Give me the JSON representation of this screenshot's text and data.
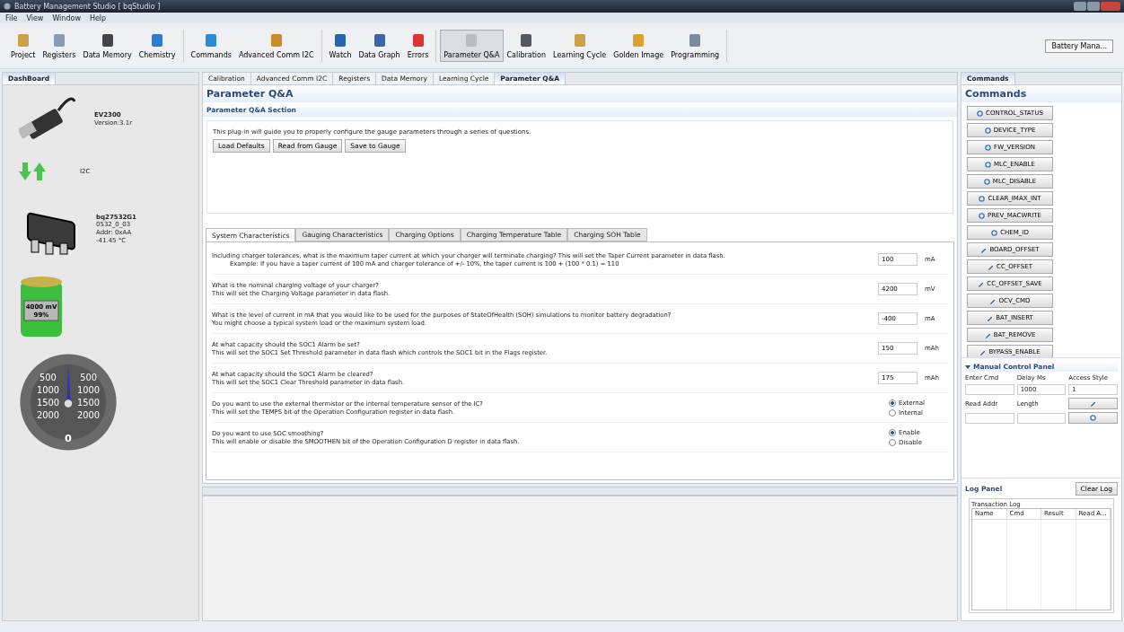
{
  "window": {
    "title": "Battery Management Studio [ bqStudio ]"
  },
  "menu": [
    "File",
    "View",
    "Window",
    "Help"
  ],
  "toolbar": {
    "groups": [
      [
        {
          "label": "Project",
          "selected": false
        },
        {
          "label": "Registers",
          "selected": false
        },
        {
          "label": "Data Memory",
          "selected": false
        },
        {
          "label": "Chemistry",
          "selected": false
        }
      ],
      [
        {
          "label": "Commands",
          "selected": false
        },
        {
          "label": "Advanced Comm I2C",
          "selected": false
        }
      ],
      [
        {
          "label": "Watch",
          "selected": false
        },
        {
          "label": "Data Graph",
          "selected": false
        },
        {
          "label": "Errors",
          "selected": false
        }
      ],
      [
        {
          "label": "Parameter Q&A",
          "selected": true
        },
        {
          "label": "Calibration",
          "selected": false
        },
        {
          "label": "Learning Cycle",
          "selected": false
        },
        {
          "label": "Golden Image",
          "selected": false
        },
        {
          "label": "Programming",
          "selected": false
        }
      ]
    ],
    "perspective": "Battery Mana..."
  },
  "dashboard": {
    "tab": "DashBoard",
    "adapter": {
      "name": "EV2300",
      "version": "Version:3.1r"
    },
    "bus": "I2C",
    "gauge_device": {
      "name": "bq27532G1",
      "lines": [
        "0532_0_03",
        "Addr: 0xAA",
        "-41.45 °C"
      ]
    },
    "battery": {
      "voltage": "4000 mV",
      "charge": "99%",
      "level": 0.99
    },
    "dial": {
      "labels": [
        "500",
        "500",
        "1000",
        "1000",
        "1500",
        "1500",
        "2000",
        "2000"
      ],
      "reading": "0"
    }
  },
  "editor_tabs": [
    {
      "label": "Calibration",
      "selected": false
    },
    {
      "label": "Advanced Comm I2C",
      "selected": false
    },
    {
      "label": "Registers",
      "selected": false
    },
    {
      "label": "Data Memory",
      "selected": false
    },
    {
      "label": "Learning Cycle",
      "selected": false
    },
    {
      "label": "Parameter Q&A",
      "selected": true
    }
  ],
  "parameter_qa": {
    "title": "Parameter Q&A",
    "section": "Parameter Q&A Section",
    "intro": "This plug-in will guide you to properly configure the gauge parameters through a series of questions.",
    "buttons": [
      "Load Defaults",
      "Read from Gauge",
      "Save to Gauge"
    ],
    "tabs": [
      {
        "label": "System Characteristics",
        "selected": true
      },
      {
        "label": "Gauging Characteristics",
        "selected": false
      },
      {
        "label": "Charging Options",
        "selected": false
      },
      {
        "label": "Charging Temperature Table",
        "selected": false
      },
      {
        "label": "Charging SOH Table",
        "selected": false
      }
    ],
    "questions": [
      {
        "kind": "number",
        "lines": [
          "Including charger tolerances, what is the maximum taper current at which your charger will terminate charging?  This will set the Taper Current parameter in data flash.",
          "Example: If you have a taper current of 100 mA and charger tolerance of +/- 10%, the taper current is 100 + (100 * 0.1) = 110"
        ],
        "value": "100",
        "unit": "mA"
      },
      {
        "kind": "number",
        "lines": [
          "What is the nominal charging voltage of your charger?",
          "This will set the Charging Voltage parameter in data flash."
        ],
        "value": "4200",
        "unit": "mV"
      },
      {
        "kind": "number",
        "lines": [
          "What is the level of current in mA that you would like to be used for the purposes of StateOfHealth (SOH) simulations to monitor battery degradation?",
          "You might choose a typical system load or the maximum system load."
        ],
        "value": "-400",
        "unit": "mA"
      },
      {
        "kind": "number",
        "lines": [
          "At what capacity should the SOC1 Alarm be set?",
          "This will set the SOC1 Set Threshold parameter in data flash which controls the SOC1 bit in the Flags register."
        ],
        "value": "150",
        "unit": "mAh"
      },
      {
        "kind": "number",
        "lines": [
          "At what capacity should the SOC1 Alarm be cleared?",
          "This will set the SOC1 Clear Threshold parameter in data flash."
        ],
        "value": "175",
        "unit": "mAh"
      },
      {
        "kind": "radio",
        "lines": [
          "Do you want to use the external thermistor or the internal temperature sensor of the IC?",
          "This will set the TEMPS bit of the Operation Configuration register in data flash."
        ],
        "options": [
          {
            "label": "External",
            "selected": true
          },
          {
            "label": "Internal",
            "selected": false
          }
        ]
      },
      {
        "kind": "radio",
        "lines": [
          "Do you want to use SOC smoothing?",
          "This will enable or disable the SMOOTHEN bit of the Operation Configuration D register in data flash."
        ],
        "options": [
          {
            "label": "Enable",
            "selected": true
          },
          {
            "label": "Disable",
            "selected": false
          }
        ]
      }
    ]
  },
  "commands_panel": {
    "tab": "Commands",
    "title": "Commands",
    "commands": [
      {
        "label": "CONTROL_STATUS",
        "kind": "read"
      },
      {
        "label": "DEVICE_TYPE",
        "kind": "read"
      },
      {
        "label": "FW_VERSION",
        "kind": "read"
      },
      {
        "label": "MLC_ENABLE",
        "kind": "read"
      },
      {
        "label": "MLC_DISABLE",
        "kind": "read"
      },
      {
        "label": "CLEAR_IMAX_INT",
        "kind": "read"
      },
      {
        "label": "PREV_MACWRITE",
        "kind": "read"
      },
      {
        "label": "CHEM_ID",
        "kind": "read"
      },
      {
        "label": "BOARD_OFFSET",
        "kind": "write"
      },
      {
        "label": "CC_OFFSET",
        "kind": "write"
      },
      {
        "label": "CC_OFFSET_SAVE",
        "kind": "write"
      },
      {
        "label": "OCV_CMD",
        "kind": "write"
      },
      {
        "label": "BAT_INSERT",
        "kind": "write"
      },
      {
        "label": "BAT_REMOVE",
        "kind": "write"
      },
      {
        "label": "BYPASS_ENABLE",
        "kind": "write"
      }
    ],
    "manual": {
      "title": "Manual Control Panel",
      "expanded": true,
      "enter_cmd": "Enter Cmd",
      "delay_label": "Delay Ms",
      "delay": "1000",
      "access_label": "Access Style",
      "access": "1",
      "read_addr": "Read Addr",
      "length": "Length"
    },
    "log": {
      "title": "Log Panel",
      "clear": "Clear Log",
      "group": "Transaction Log",
      "columns": [
        "Name",
        "Cmd",
        "Result",
        "Read A..."
      ]
    }
  }
}
